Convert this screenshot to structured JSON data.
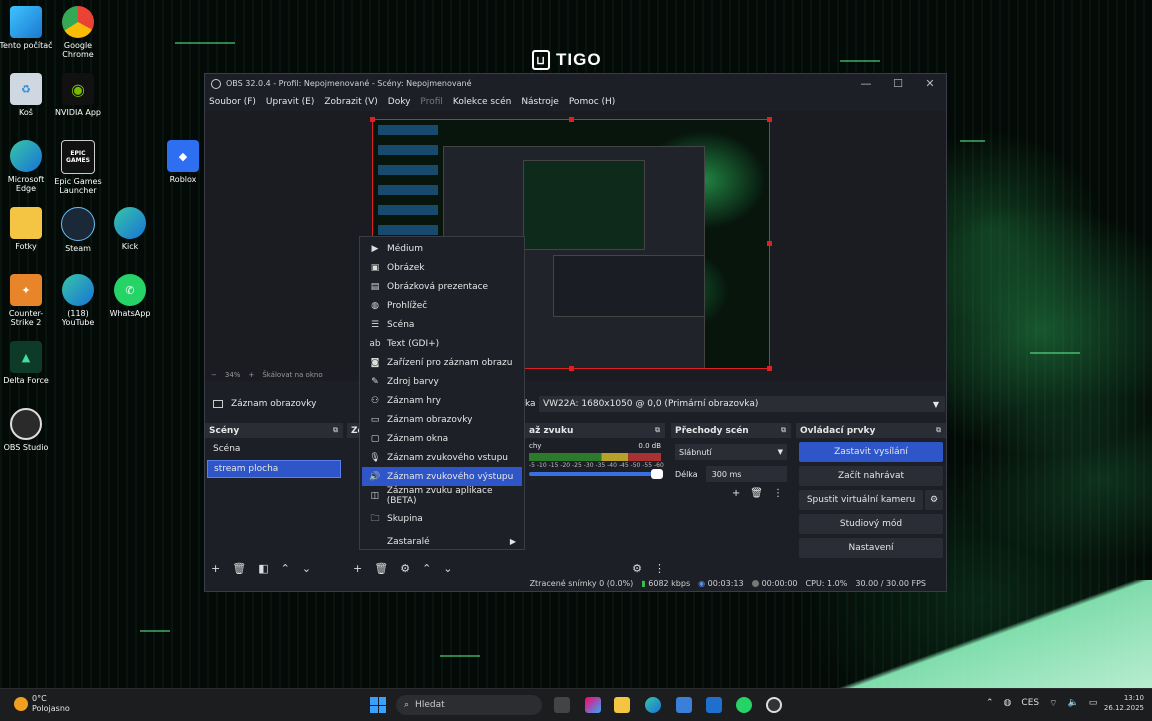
{
  "desktop": {
    "brand": "TIGO",
    "icons": [
      {
        "label": "Tento počítač"
      },
      {
        "label": "Google Chrome"
      },
      {
        "label": "Koš"
      },
      {
        "label": "NVIDIA App"
      },
      {
        "label": "Microsoft Edge"
      },
      {
        "label": "Epic Games Launcher",
        "badge": "EPIC GAMES"
      },
      {
        "label": "Roblox"
      },
      {
        "label": "Fotky"
      },
      {
        "label": "Steam"
      },
      {
        "label": "Kick"
      },
      {
        "label": "Counter-Strike 2"
      },
      {
        "label": "(118) YouTube"
      },
      {
        "label": "WhatsApp"
      },
      {
        "label": "Delta Force"
      },
      {
        "label": "OBS Studio"
      }
    ]
  },
  "obs": {
    "title": "OBS 32.0.4 - Profil: Nepojmenované - Scény: Nepojmenované",
    "controls": {
      "minimize": "—",
      "maximize": "☐",
      "close": "✕"
    },
    "menu": [
      "Soubor (F)",
      "Upravit (E)",
      "Zobrazit (V)",
      "Doky",
      "Profil",
      "Kolekce scén",
      "Nástroje",
      "Pomoc (H)"
    ],
    "preview_bar": {
      "zoom_out": "−",
      "zoom": "34%",
      "zoom_in": "+",
      "scale": "Škálovat na okno"
    },
    "source_bar": {
      "name": "Záznam obrazovky",
      "display_label": "ka",
      "display": "VW22A: 1680x1050 @ 0,0 (Primární obrazovka)"
    },
    "scenes": {
      "title": "Scény",
      "items": [
        "Scéna",
        "stream plocha"
      ],
      "active_index": 1
    },
    "sources_title": "Zd",
    "mixer": {
      "title": "až zvuku",
      "channel": "chy",
      "db": "0.0 dB",
      "scale": "-5 -10 -15 -20 -25 -30 -35 -40 -45 -50 -55 -60"
    },
    "transitions": {
      "title": "Přechody scén",
      "type": "Slábnutí",
      "duration_label": "Délka",
      "duration": "300 ms"
    },
    "controls_dock": {
      "title": "Ovládací prvky",
      "buttons": [
        "Zastavit vysílání",
        "Začít nahrávat",
        "Spustit virtuální kameru",
        "Studiový mód",
        "Nastavení"
      ]
    },
    "status": {
      "dropped": "Ztracené snímky 0 (0.0%)",
      "bitrate": "6082 kbps",
      "stream_time": "00:03:13",
      "record_time": "00:00:00",
      "cpu": "CPU: 1.0%",
      "fps": "30.00 / 30.00 FPS"
    }
  },
  "context_menu": {
    "items": [
      {
        "label": "Médium",
        "icon": "play-icon"
      },
      {
        "label": "Obrázek",
        "icon": "image-icon"
      },
      {
        "label": "Obrázková prezentace",
        "icon": "slideshow-icon"
      },
      {
        "label": "Prohlížeč",
        "icon": "globe-icon"
      },
      {
        "label": "Scéna",
        "icon": "list-icon"
      },
      {
        "label": "Text (GDI+)",
        "icon": "text-icon"
      },
      {
        "label": "Zařízení pro záznam obrazu",
        "icon": "camera-icon"
      },
      {
        "label": "Zdroj barvy",
        "icon": "brush-icon"
      },
      {
        "label": "Záznam hry",
        "icon": "gamepad-icon"
      },
      {
        "label": "Záznam obrazovky",
        "icon": "monitor-icon"
      },
      {
        "label": "Záznam okna",
        "icon": "window-icon"
      },
      {
        "label": "Záznam zvukového vstupu",
        "icon": "microphone-icon"
      },
      {
        "label": "Záznam zvukového výstupu",
        "icon": "speaker-icon"
      },
      {
        "label": "Záznam zvuku aplikace (BETA)",
        "icon": "app-audio-icon"
      },
      {
        "label": "Skupina",
        "icon": "folder-icon"
      },
      {
        "label": "Zastaralé",
        "icon": "",
        "submenu": "▶"
      }
    ],
    "highlighted_index": 12
  },
  "taskbar": {
    "weather_temp": "0°C",
    "weather_text": "Polojasno",
    "search_placeholder": "Hledat",
    "language": "CES",
    "time": "13:10",
    "date": "26.12.2025"
  }
}
